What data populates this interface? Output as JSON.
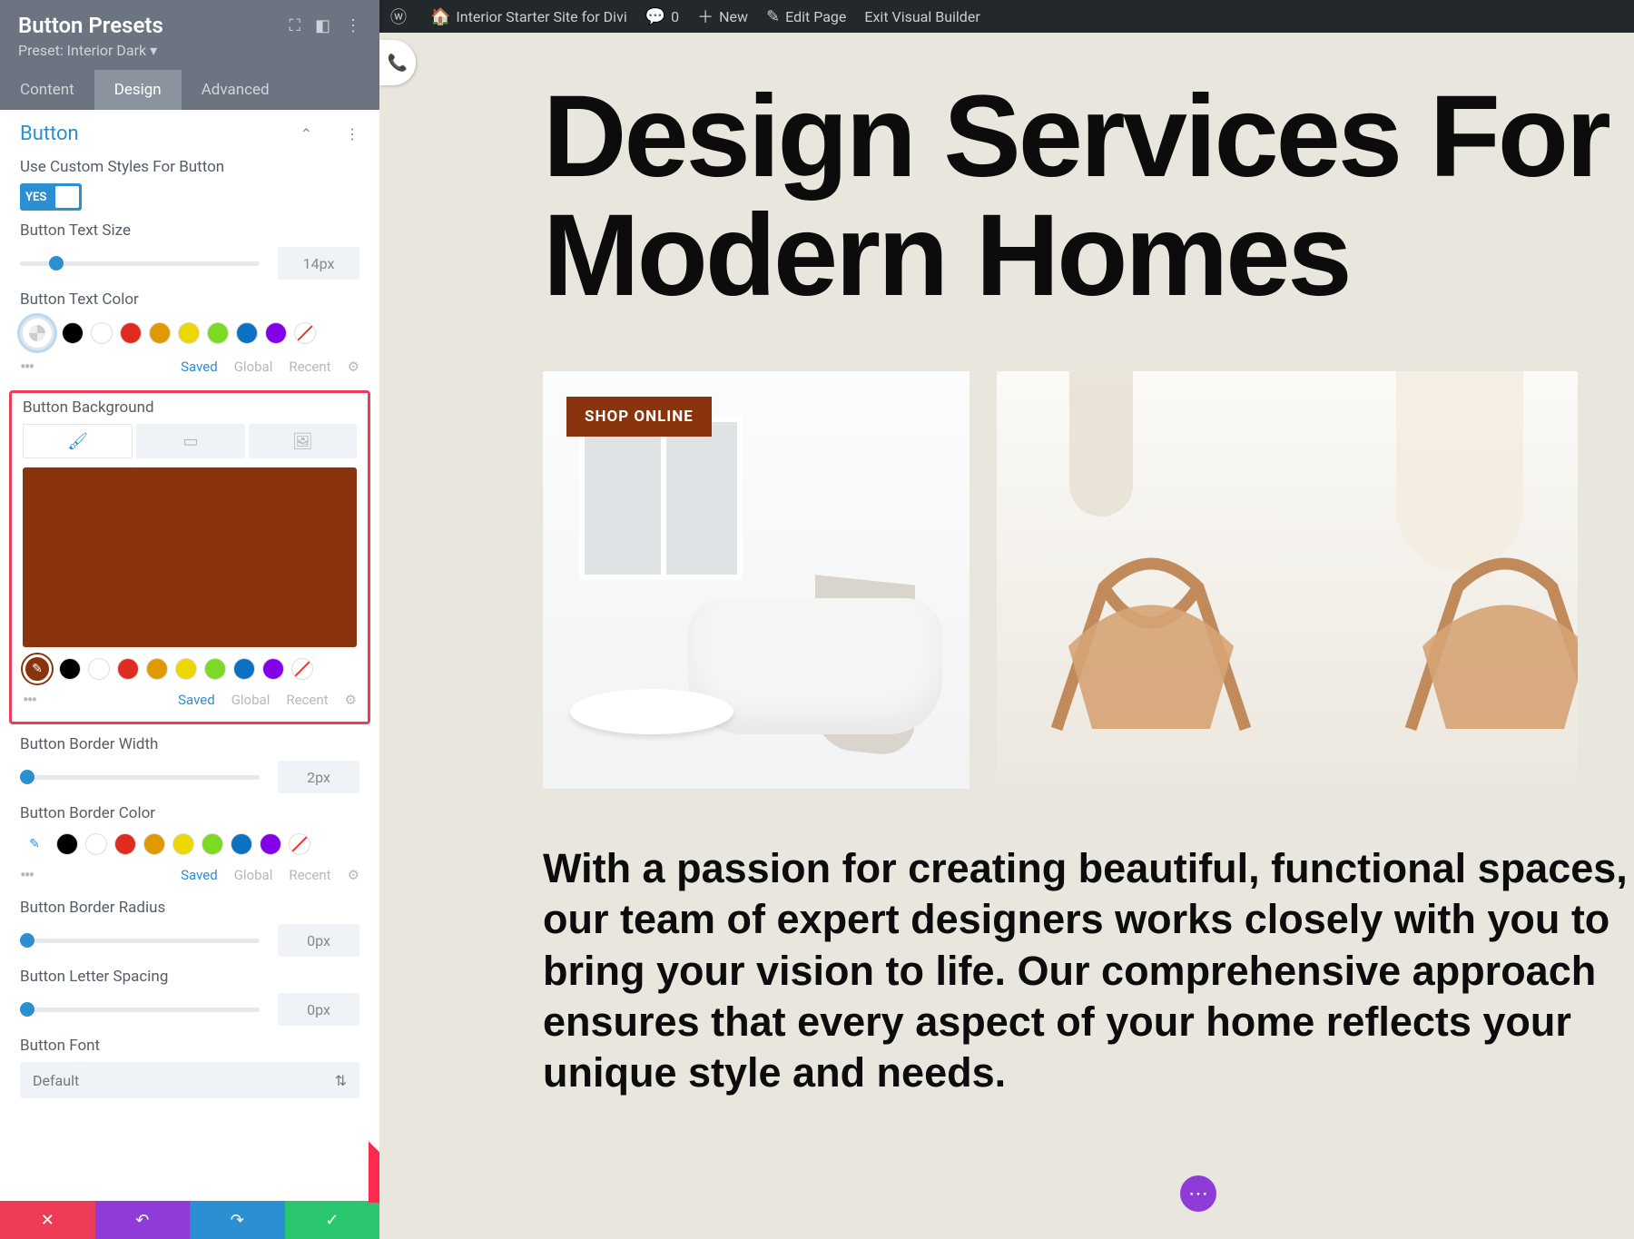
{
  "adminbar": {
    "site": "Interior Starter Site for Divi",
    "comments": "0",
    "new": "New",
    "edit": "Edit Page",
    "exit": "Exit Visual Builder"
  },
  "panel": {
    "title": "Button Presets",
    "preset": "Preset: Interior Dark ▾",
    "tabs": {
      "content": "Content",
      "design": "Design",
      "advanced": "Advanced"
    },
    "section": "Button",
    "custom_styles_label": "Use Custom Styles For Button",
    "toggle_yes": "YES",
    "text_size_label": "Button Text Size",
    "text_size_value": "14px",
    "text_color_label": "Button Text Color",
    "bg_label": "Button Background",
    "border_width_label": "Button Border Width",
    "border_width_value": "2px",
    "border_color_label": "Button Border Color",
    "border_radius_label": "Button Border Radius",
    "border_radius_value": "0px",
    "letter_spacing_label": "Button Letter Spacing",
    "letter_spacing_value": "0px",
    "font_label": "Button Font",
    "font_value": "Default",
    "meta": {
      "saved": "Saved",
      "global": "Global",
      "recent": "Recent"
    }
  },
  "colors": {
    "palette": [
      "#000000",
      "#ffffff",
      "#e02b20",
      "#e09900",
      "#edd700",
      "#7cda24",
      "#0c71c3",
      "#8300e9"
    ],
    "bg_selected": "#8a340d",
    "picker_icon_bg": "#ffffff",
    "picker_icon_color": "#2c8fd1"
  },
  "preview": {
    "headline": "Design Services For Modern Homes",
    "shop_button": "SHOP ONLINE",
    "subhead": "With a passion for creating beautiful, functional spaces, our team of expert designers works closely with you to bring your vision to life. Our comprehensive approach ensures that every aspect of your home reflects your unique style and needs."
  }
}
